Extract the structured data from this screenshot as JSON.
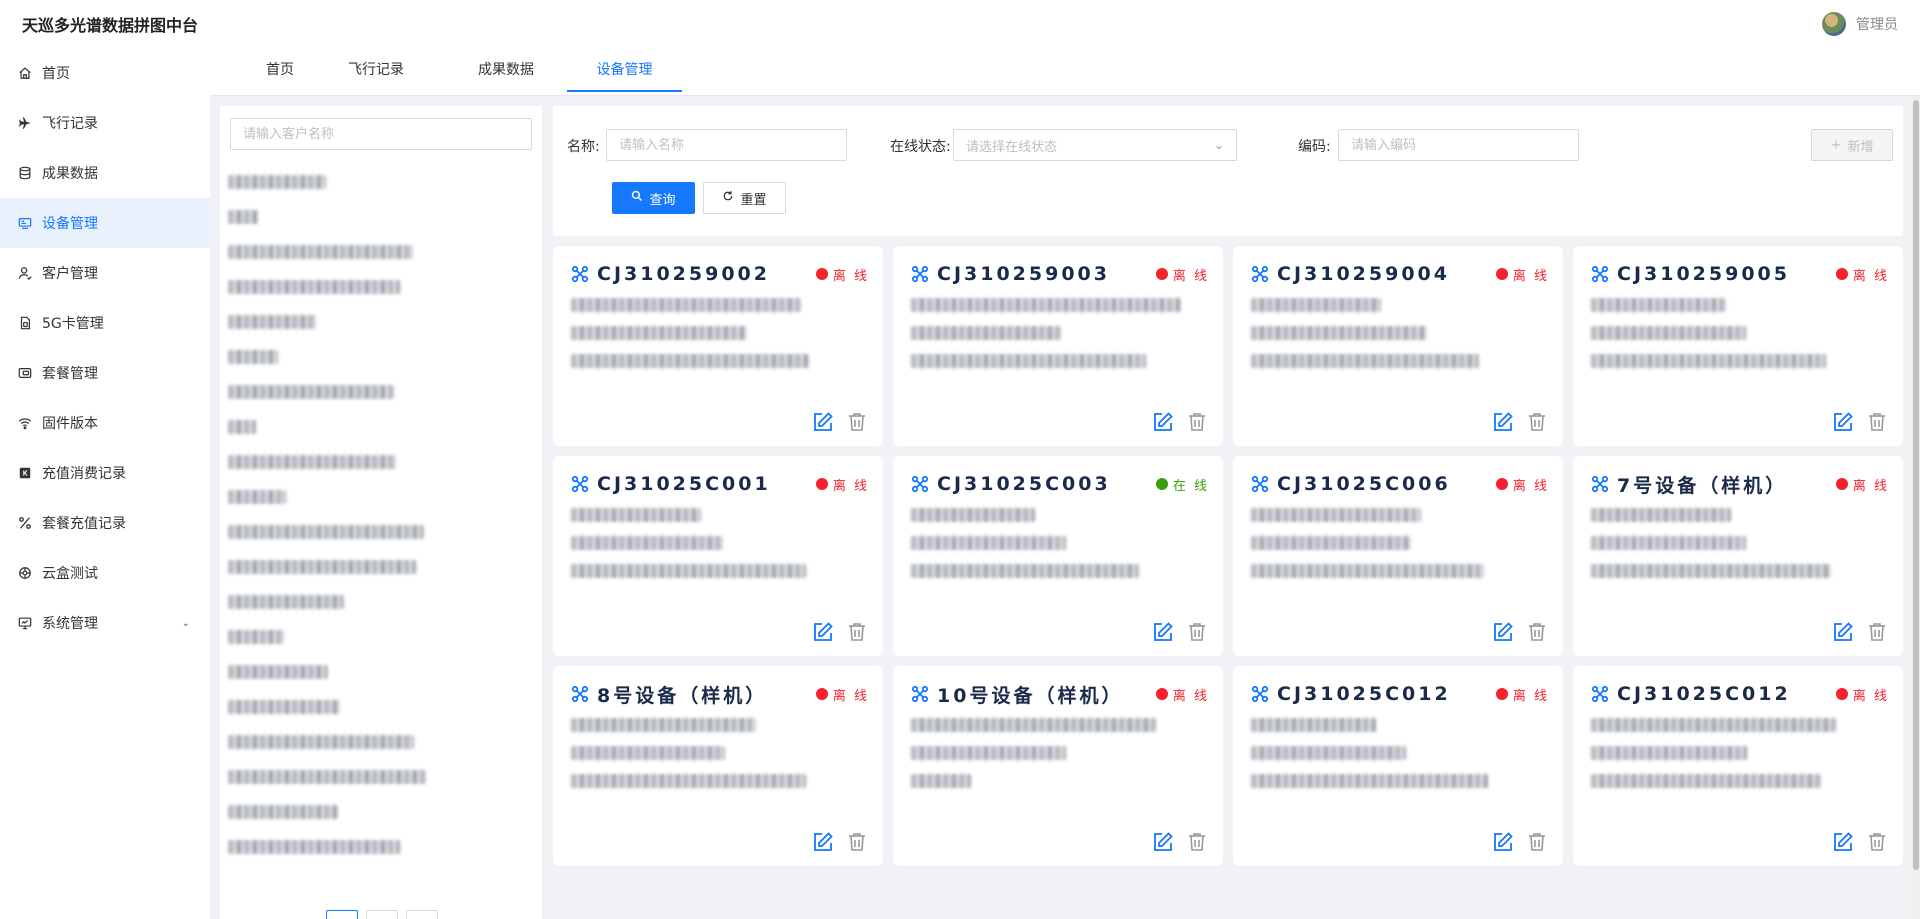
{
  "app": {
    "title": "天巡多光谱数据拼图中台",
    "user": "管理员"
  },
  "sidebar": {
    "items": [
      {
        "label": "首页",
        "icon": "home-icon"
      },
      {
        "label": "飞行记录",
        "icon": "plane-icon"
      },
      {
        "label": "成果数据",
        "icon": "database-icon"
      },
      {
        "label": "设备管理",
        "icon": "device-icon",
        "active": true
      },
      {
        "label": "客户管理",
        "icon": "user-icon"
      },
      {
        "label": "5G卡管理",
        "icon": "sim-card-icon"
      },
      {
        "label": "套餐管理",
        "icon": "package-icon"
      },
      {
        "label": "固件版本",
        "icon": "wifi-icon"
      },
      {
        "label": "充值消费记录",
        "icon": "recharge-icon"
      },
      {
        "label": "套餐充值记录",
        "icon": "percent-icon"
      },
      {
        "label": "云盒测试",
        "icon": "cloud-box-icon"
      },
      {
        "label": "系统管理",
        "icon": "monitor-icon"
      }
    ]
  },
  "tabs": [
    {
      "label": "首页"
    },
    {
      "label": "飞行记录"
    },
    {
      "label": "成果数据"
    },
    {
      "label": "设备管理",
      "active": true
    }
  ],
  "customer_panel": {
    "search_placeholder": "请输入客户名称"
  },
  "filters": {
    "name_label": "名称:",
    "name_placeholder": "请输入名称",
    "status_label": "在线状态:",
    "status_placeholder": "请选择在线状态",
    "code_label": "编码:",
    "code_placeholder": "请输入编码",
    "add_label": "新增",
    "query_label": "查询",
    "reset_label": "重置"
  },
  "devices": [
    {
      "name": "CJ310259002",
      "status": "离 线"
    },
    {
      "name": "CJ310259003",
      "status": "离 线"
    },
    {
      "name": "CJ310259004",
      "status": "离 线"
    },
    {
      "name": "CJ310259005",
      "status": "离 线"
    },
    {
      "name": "CJ31025C001",
      "status": "离 线"
    },
    {
      "name": "CJ31025C003",
      "status": "在 线"
    },
    {
      "name": "CJ31025C006",
      "status": "离 线"
    },
    {
      "name": "7号设备（样机）",
      "status": "离 线"
    },
    {
      "name": "8号设备（样机）",
      "status": "离 线"
    },
    {
      "name": "10号设备（样机）",
      "status": "离 线"
    },
    {
      "name": "CJ31025C012",
      "status": "离 线"
    },
    {
      "name": "CJ31025C012",
      "status": "离 线"
    }
  ],
  "colors": {
    "accent": "#1677ff",
    "offline": "#f5222d",
    "online": "#389e0d",
    "title": "#1a2a4a"
  }
}
